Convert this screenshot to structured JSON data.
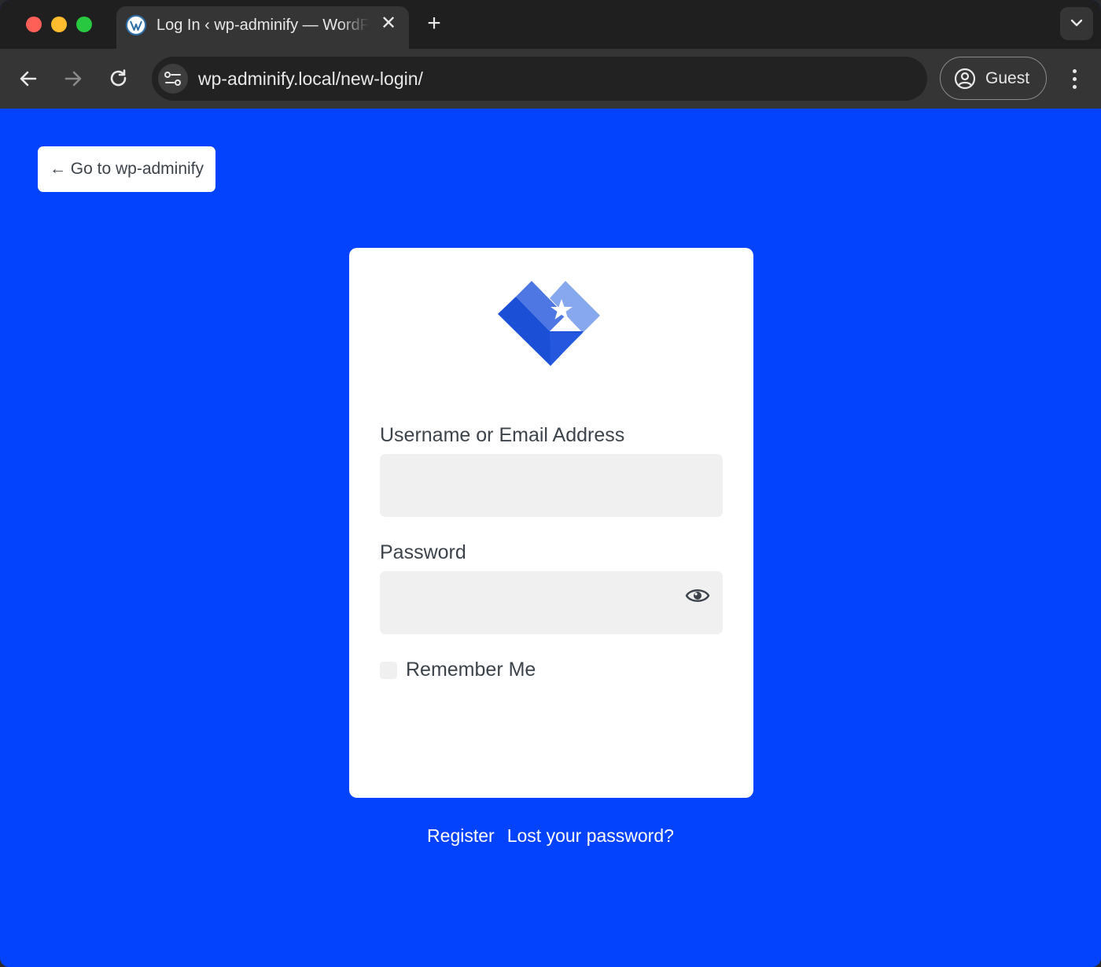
{
  "browser": {
    "tab": {
      "title": "Log In ‹ wp-adminify — WordPress",
      "close_glyph": "✕",
      "icon": "wordpress-icon"
    },
    "new_tab_glyph": "+",
    "address_bar": {
      "url": "wp-adminify.local/new-login/"
    },
    "profile": {
      "label": "Guest",
      "icon": "account-circle-icon"
    }
  },
  "page": {
    "background_color": "#0443fd",
    "back_link": "← Go to wp-adminify",
    "login_form": {
      "username_label": "Username or Email Address",
      "username_value": "",
      "password_label": "Password",
      "password_value": "",
      "remember_label": "Remember Me",
      "remember_checked": false
    },
    "footer_links": {
      "register": "Register",
      "lost_password": "Lost your password?"
    }
  }
}
